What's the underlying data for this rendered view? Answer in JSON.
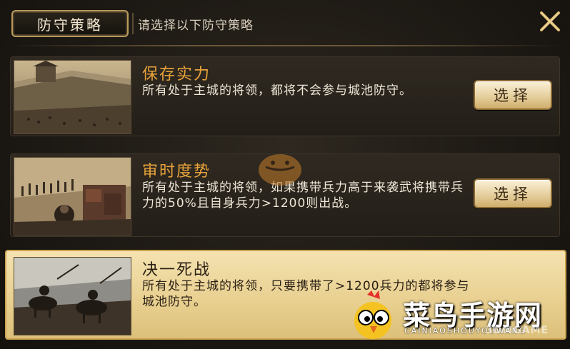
{
  "header": {
    "tab_label": "防守策略",
    "hint": "请选择以下防守策略",
    "close_icon": "close-icon"
  },
  "options": [
    {
      "title": "保存实力",
      "desc": "所有处于主城的将领，都将不会参与城池防守。",
      "button": "选择",
      "thumb_icon": "fortress-image"
    },
    {
      "title": "审时度势",
      "desc": "所有处于主城的将领，如果携带兵力高于来袭武将携带兵力的50%且自身兵力>1200则出战。",
      "button": "选择",
      "thumb_icon": "army-march-image"
    },
    {
      "title": "决一死战",
      "desc": "所有处于主城的将领，只要携带了>1200兵力的都将参与城池防守。",
      "thumb_icon": "cavalry-battle-image"
    }
  ],
  "watermark": {
    "text": "菜鸟手游网",
    "sub": "CAINIAOSHOUYOUWANG",
    "sub2": "3DMGAME"
  },
  "colors": {
    "accent": "#e7a23a",
    "selected_bg": "#e8cf8f",
    "border_gold": "#c9a24f"
  }
}
